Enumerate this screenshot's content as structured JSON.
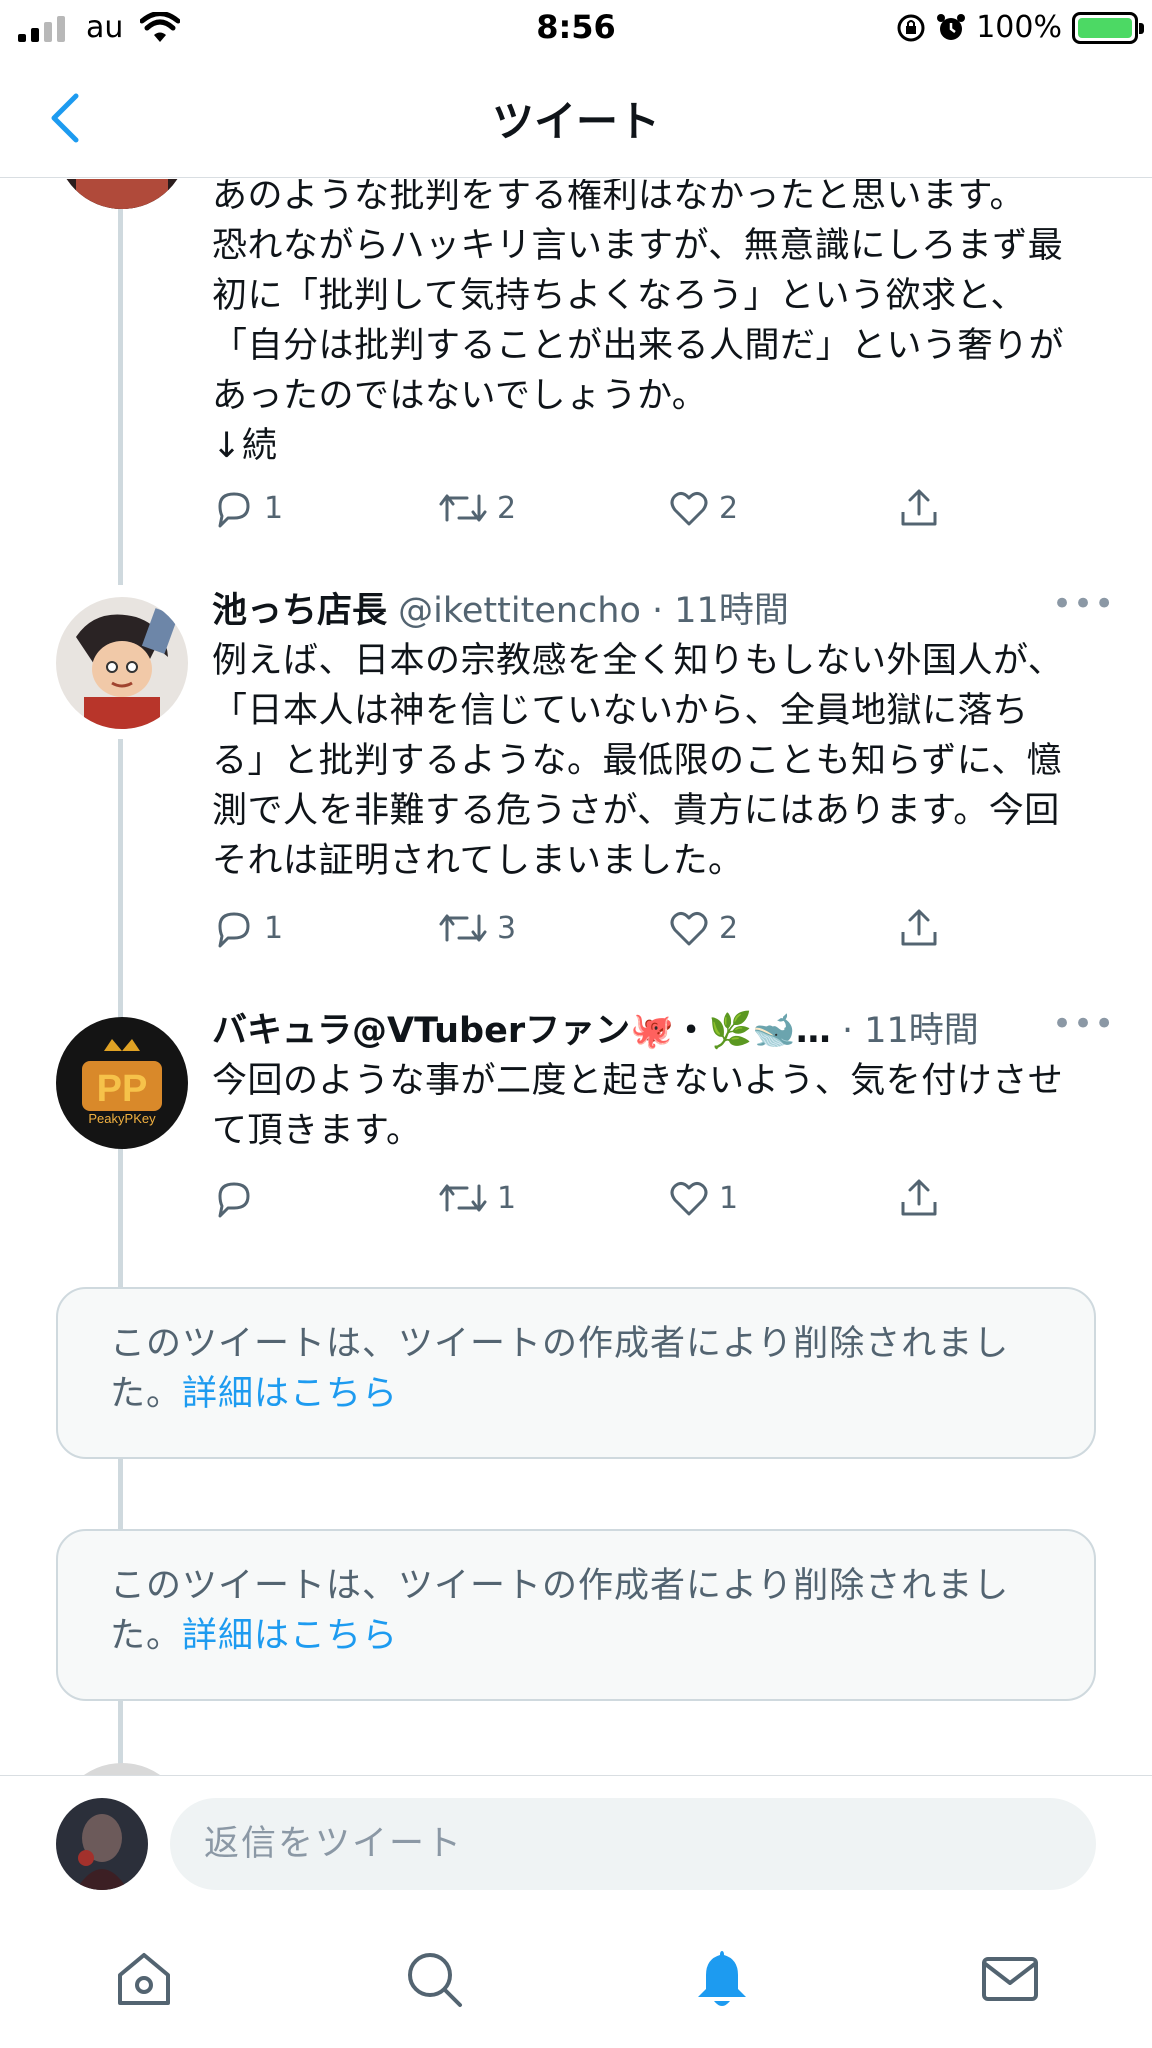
{
  "status_bar": {
    "carrier": "au",
    "time": "8:56",
    "battery_percent": "100%",
    "battery_level": 1.0
  },
  "header": {
    "title": "ツイート"
  },
  "tweets": [
    {
      "text_lines": [
        "あのような批判をする権利はなかったと思います。",
        "恐れながらハッキリ言いますが、無意識にしろまず最",
        "初に「批判して気持ちよくなろう」という欲求と、",
        "「自分は批判することが出来る人間だ」という奢りが",
        "あったのではないでしょうか。",
        "↓続"
      ],
      "reply_count": "1",
      "retweet_count": "2",
      "like_count": "2"
    },
    {
      "name": "池っち店長",
      "handle": "@ikettitencho",
      "time": "· 11時間",
      "text_lines": [
        "例えば、日本の宗教感を全く知りもしない外国人が、",
        "「日本人は神を信じていないから、全員地獄に落ち",
        "る」と批判するような。最低限のことも知らずに、憶",
        "測で人を非難する危うさが、貴方にはあります。今回",
        "それは証明されてしまいました。"
      ],
      "reply_count": "1",
      "retweet_count": "3",
      "like_count": "2"
    },
    {
      "name": "バキュラ@VTuberファン🐙・🌿🐋…",
      "time": "· 11時間",
      "text_lines": [
        "今回のような事が二度と起きないよう、気を付けさせ",
        "て頂きます。"
      ],
      "reply_count": "",
      "retweet_count": "1",
      "like_count": "1"
    }
  ],
  "deleted_notices": [
    {
      "text": "このツイートは、ツイートの作成者により削除されまし",
      "text2": "た。",
      "link": "詳細はこちら"
    },
    {
      "text": "このツイートは、ツイートの作成者により削除されまし",
      "text2": "た。",
      "link": "詳細はこちら"
    }
  ],
  "composer": {
    "placeholder": "返信をツイート"
  },
  "icons": {
    "more": "more-icon",
    "reply": "reply-icon",
    "retweet": "retweet-icon",
    "like": "like-icon",
    "share": "share-icon",
    "tabs": [
      "home-icon",
      "search-icon",
      "notifications-icon",
      "messages-icon"
    ]
  },
  "colors": {
    "accent": "#1d9bf0",
    "secondary_text": "#536471",
    "thread_line": "#cfd9de"
  }
}
